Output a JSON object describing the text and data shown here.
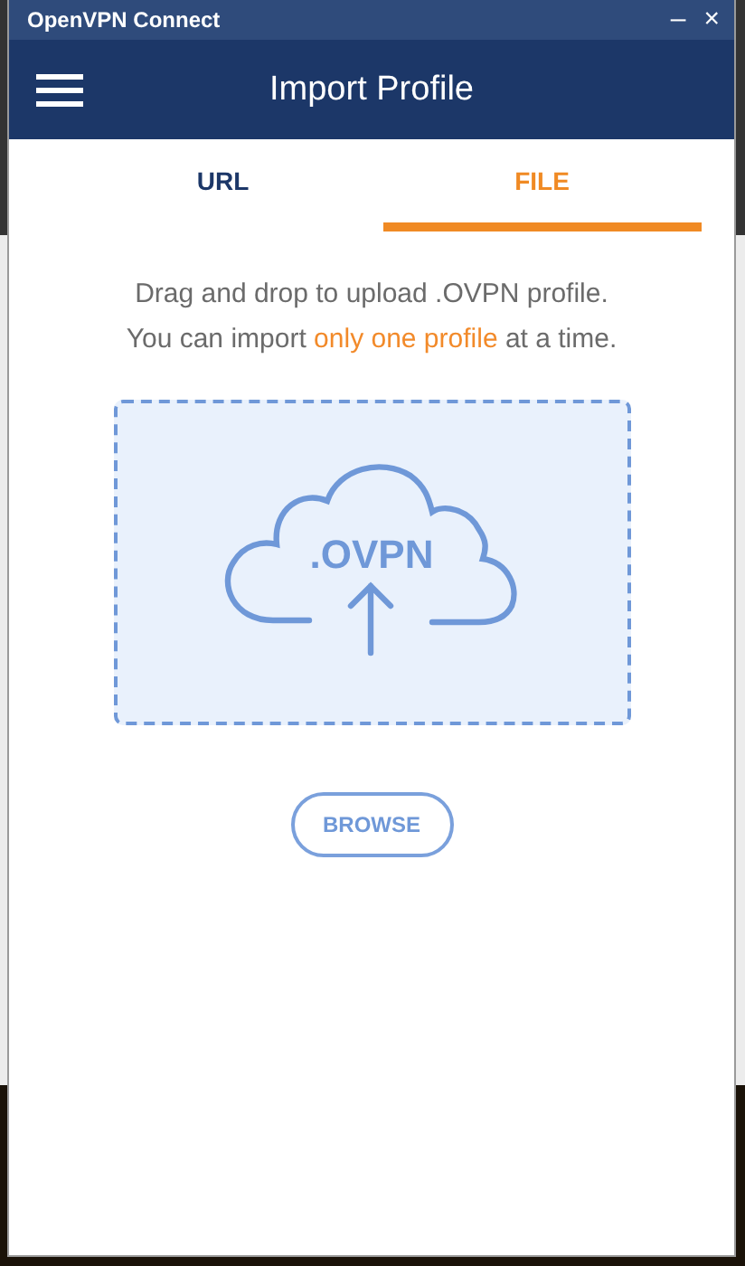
{
  "window": {
    "title": "OpenVPN Connect",
    "controls": [
      "–",
      "×"
    ]
  },
  "header": {
    "title": "Import Profile"
  },
  "tabs": [
    {
      "label": "URL",
      "selected": false
    },
    {
      "label": "FILE",
      "selected": true
    }
  ],
  "instructions": [
    [
      {
        "text": "Drag and drop to upload .OVPN profile.",
        "highlight": false
      }
    ],
    [
      {
        "text": "You can import ",
        "highlight": false
      },
      {
        "text": "only one profile",
        "highlight": true
      },
      {
        "text": " at a time.",
        "highlight": false
      }
    ]
  ],
  "dropzone": {
    "label": ".OVPN"
  },
  "button": {
    "label": "BROWSE"
  }
}
